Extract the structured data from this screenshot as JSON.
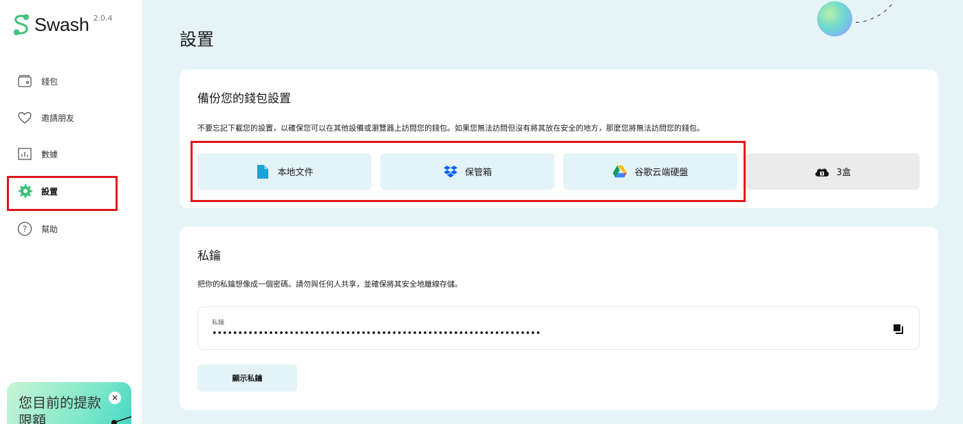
{
  "app": {
    "name": "Swash",
    "version": "2.0.4",
    "brand_color": "#3dbf7a"
  },
  "sidebar": {
    "items": [
      {
        "label": "錢包",
        "icon": "wallet-icon"
      },
      {
        "label": "邀請朋友",
        "icon": "heart-icon"
      },
      {
        "label": "數據",
        "icon": "chart-icon"
      },
      {
        "label": "設置",
        "icon": "gear-icon",
        "active": true
      },
      {
        "label": "幫助",
        "icon": "help-icon"
      }
    ],
    "promo": {
      "text": "您目前的提款限額",
      "close_icon": "close-icon"
    }
  },
  "main": {
    "title": "設置",
    "backup": {
      "title": "備份您的錢包設置",
      "description": "不要忘記下載您的設置，以確保您可以在其他設備或瀏覽器上訪問您的錢包。如果您無法訪問但沒有將其放在安全的地方，那麼您將無法訪問您的錢包。",
      "options": [
        {
          "label": "本地文件",
          "icon": "file-icon",
          "color": "#1aa3d9"
        },
        {
          "label": "保管箱",
          "icon": "dropbox-icon",
          "color": "#0061fe"
        },
        {
          "label": "谷歌云端硬盤",
          "icon": "google-drive-icon"
        },
        {
          "label": "3盒",
          "icon": "cloud-icon",
          "disabled": true
        }
      ]
    },
    "private_key": {
      "title": "私鑰",
      "description": "把你的私鑰想像成一個密碼。請勿與任何人共享，並確保將其安全地離線存儲。",
      "field_label": "私鑰",
      "field_value": "••••••••••••••••••••••••••••••••••••••••••••••••••••••••••••••••",
      "show_button": "顯示私鑰"
    }
  },
  "annotations": {
    "highlight_color": "#e0141b"
  }
}
